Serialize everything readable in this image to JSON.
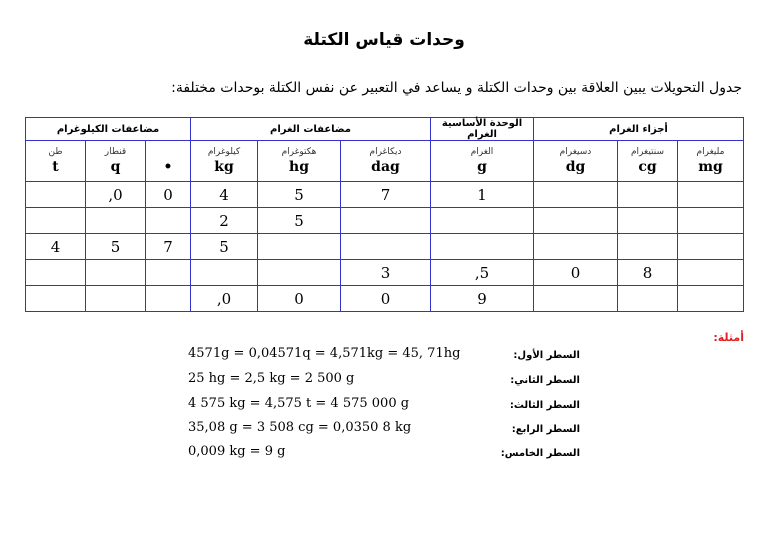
{
  "title": "وحدات قياس الكتلة",
  "intro": "جدول التحويلات يبين العلاقة بين وحدات الكتلة و يساعد في التعبير عن نفس الكتلة بوحدات مختلفة:",
  "table": {
    "group_headers": [
      "أجزاء الغرام",
      "الوحدة الأساسية الغرام",
      "مضاعفات الغرام",
      "مضاعفات الكيلوغرام"
    ],
    "units": [
      {
        "ar": "مليغرام",
        "sym": "mg"
      },
      {
        "ar": "سنتيغرام",
        "sym": "cg"
      },
      {
        "ar": "دسيغرام",
        "sym": "dg"
      },
      {
        "ar": "الغرام",
        "sym": "g"
      },
      {
        "ar": "ديكاغرام",
        "sym": "dag"
      },
      {
        "ar": "هكتوغرام",
        "sym": "hg"
      },
      {
        "ar": "كيلوغرام",
        "sym": "kg"
      },
      {
        "ar": "",
        "sym": "•"
      },
      {
        "ar": "قنطار",
        "sym": "q"
      },
      {
        "ar": "طن",
        "sym": "t"
      }
    ],
    "rows": [
      [
        "",
        "",
        "",
        "1",
        "7",
        "5",
        "4",
        "0",
        "0,",
        ""
      ],
      [
        "",
        "",
        "",
        "",
        "",
        "5",
        "2",
        "",
        "",
        ""
      ],
      [
        "",
        "",
        "",
        "",
        "",
        "",
        "5",
        "7",
        "5",
        "4"
      ],
      [
        "",
        "8",
        "0",
        "5,",
        "3",
        "",
        "",
        "",
        "",
        ""
      ],
      [
        "",
        "",
        "",
        "9",
        "0",
        "0",
        "0,",
        "",
        "",
        ""
      ]
    ]
  },
  "examples": {
    "label": "أمثلة:",
    "items": [
      {
        "label": "السطر الأول:",
        "equation": "4571g = 0,04571q = 4,571kg = 45, 71hg"
      },
      {
        "label": "السطر الثاني:",
        "equation": "25 hg = 2,5 kg = 2 500 g"
      },
      {
        "label": "السطر الثالث:",
        "equation": "4 575 kg = 4,575 t = 4 575 000 g"
      },
      {
        "label": "السطر الرابع:",
        "equation": "35,08 g = 3 508 cg = 0,0350 8 kg"
      },
      {
        "label": "السطر الخامس:",
        "equation": "0,009 kg = 9 g"
      }
    ]
  }
}
